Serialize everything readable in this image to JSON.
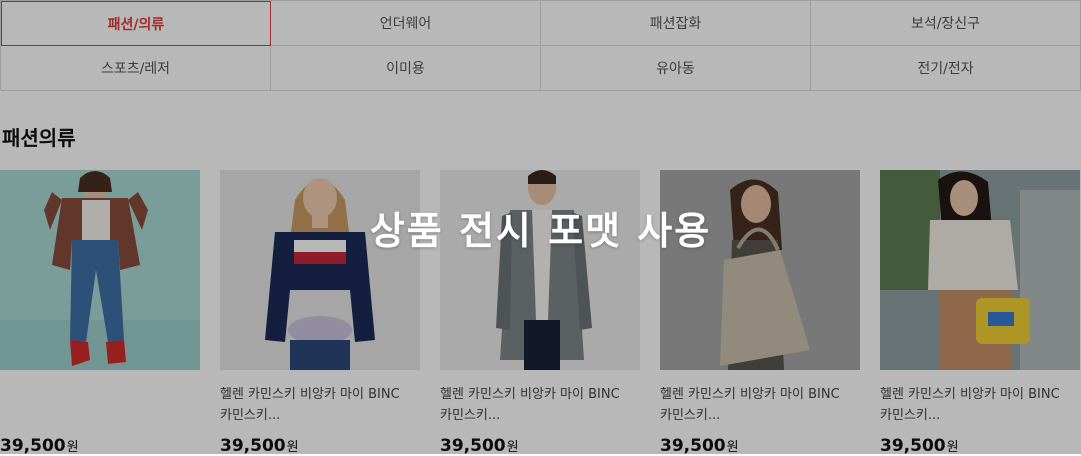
{
  "tabs": [
    {
      "label": "패션/의류",
      "active": true
    },
    {
      "label": "언더웨어",
      "active": false
    },
    {
      "label": "패션잡화",
      "active": false
    },
    {
      "label": "보석/장신구",
      "active": false
    },
    {
      "label": "스포츠/레저",
      "active": false
    },
    {
      "label": "이미용",
      "active": false
    },
    {
      "label": "유아동",
      "active": false
    },
    {
      "label": "전기/전자",
      "active": false
    }
  ],
  "section": {
    "title": "패션의류"
  },
  "products": [
    {
      "name": "",
      "price": "39,500",
      "unit": "원"
    },
    {
      "name": "헬렌 카민스키 비앙카 마이 BINC\n카민스키...",
      "price": "39,500",
      "unit": "원"
    },
    {
      "name": "헬렌 카민스키 비앙카 마이 BINC\n카민스키...",
      "price": "39,500",
      "unit": "원"
    },
    {
      "name": "헬렌 카민스키 비앙카 마이 BINC\n카민스키...",
      "price": "39,500",
      "unit": "원"
    },
    {
      "name": "헬렌 카민스키 비앙카 마이 BINC\n카민스키...",
      "price": "39,500",
      "unit": "원"
    }
  ],
  "overlay": {
    "text": "상품 전시 포맷 사용"
  },
  "colors": {
    "accent": "#e23b3b",
    "border": "#dcdcdc"
  }
}
